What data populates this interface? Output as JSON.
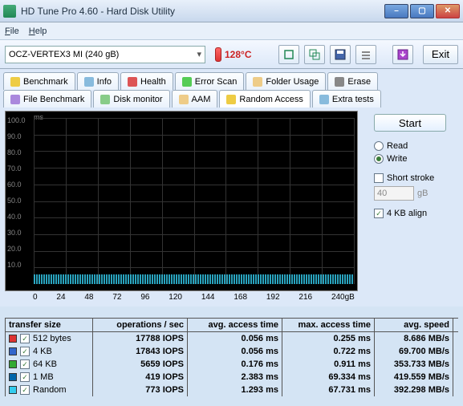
{
  "titlebar": {
    "text": "HD Tune Pro 4.60 - Hard Disk Utility"
  },
  "menu": {
    "file": "File",
    "help": "Help"
  },
  "toolbar": {
    "drive": "OCZ-VERTEX3 MI (240 gB)",
    "temp": "128°C",
    "exit": "Exit"
  },
  "tabs_row1": [
    "Benchmark",
    "Info",
    "Health",
    "Error Scan",
    "Folder Usage",
    "Erase"
  ],
  "tabs_row2": [
    "File Benchmark",
    "Disk monitor",
    "AAM",
    "Random Access",
    "Extra tests"
  ],
  "active_tab": "Random Access",
  "side": {
    "start": "Start",
    "read": "Read",
    "write": "Write",
    "short_stroke": "Short stroke",
    "stroke_val": "40",
    "stroke_unit": "gB",
    "align": "4 KB align"
  },
  "chart_data": {
    "type": "scatter",
    "title": "",
    "xlabel": "",
    "ylabel": "ms",
    "x_ticks": [
      "0",
      "24",
      "48",
      "72",
      "96",
      "120",
      "144",
      "168",
      "192",
      "216",
      "240gB"
    ],
    "y_ticks": [
      "100.0",
      "90.0",
      "80.0",
      "70.0",
      "60.0",
      "50.0",
      "40.0",
      "30.0",
      "20.0",
      "10.0"
    ],
    "xlim": [
      0,
      240
    ],
    "ylim": [
      0,
      100
    ],
    "note": "dense band of access-time points clustered below ~3 ms across full 0–240 gB range"
  },
  "table": {
    "headers": [
      "transfer size",
      "operations / sec",
      "avg. access time",
      "max. access time",
      "avg. speed"
    ],
    "rows": [
      {
        "color": "#d33",
        "size": "512 bytes",
        "ops": "17788 IOPS",
        "avg": "0.056 ms",
        "max": "0.255 ms",
        "spd": "8.686 MB/s"
      },
      {
        "color": "#36c",
        "size": "4 KB",
        "ops": "17843 IOPS",
        "avg": "0.056 ms",
        "max": "0.722 ms",
        "spd": "69.700 MB/s"
      },
      {
        "color": "#3a3",
        "size": "64 KB",
        "ops": "5659 IOPS",
        "avg": "0.176 ms",
        "max": "0.911 ms",
        "spd": "353.733 MB/s"
      },
      {
        "color": "#06a",
        "size": "1 MB",
        "ops": "419 IOPS",
        "avg": "2.383 ms",
        "max": "69.334 ms",
        "spd": "419.559 MB/s"
      },
      {
        "color": "#3ce",
        "size": "Random",
        "ops": "773 IOPS",
        "avg": "1.293 ms",
        "max": "67.731 ms",
        "spd": "392.298 MB/s"
      }
    ]
  }
}
